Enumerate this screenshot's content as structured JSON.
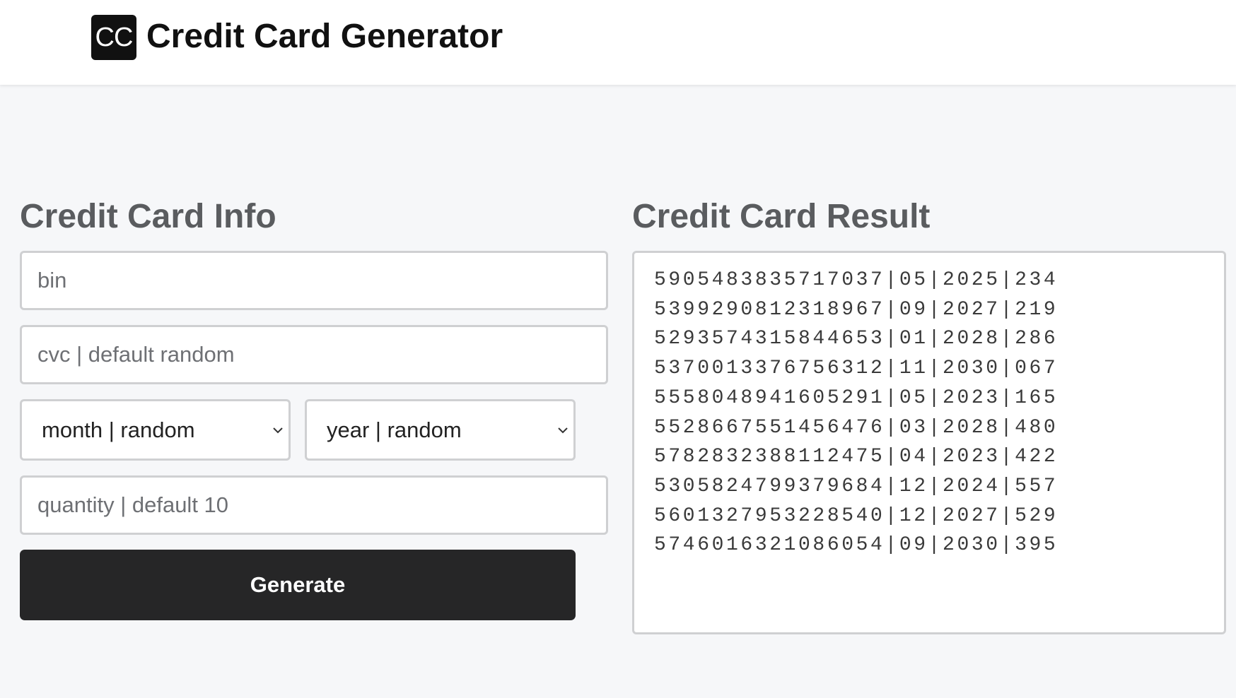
{
  "header": {
    "logo_text": "CC",
    "title": "Credit Card Generator"
  },
  "form": {
    "title": "Credit Card Info",
    "bin_placeholder": "bin",
    "cvc_placeholder": "cvc | default random",
    "month_select": "month | random",
    "year_select": "year | random",
    "quantity_placeholder": "quantity | default 10",
    "generate_label": "Generate"
  },
  "result": {
    "title": "Credit Card Result",
    "lines": [
      "5905483835717037|05|2025|234",
      "5399290812318967|09|2027|219",
      "5293574315844653|01|2028|286",
      "5370013376756312|11|2030|067",
      "5558048941605291|05|2023|165",
      "5528667551456476|03|2028|480",
      "5782832388112475|04|2023|422",
      "5305824799379684|12|2024|557",
      "5601327953228540|12|2027|529",
      "5746016321086054|09|2030|395"
    ]
  },
  "colors": {
    "page_bg": "#f6f7f9",
    "button_bg": "#262627",
    "heading": "#5a5c5f"
  }
}
